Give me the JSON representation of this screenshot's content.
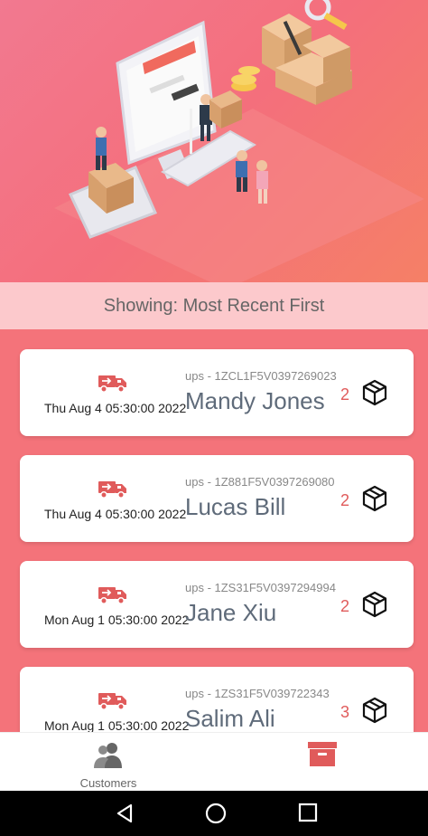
{
  "sort_label": "Showing: Most Recent First",
  "shipments": [
    {
      "date": "Thu Aug  4 05:30:00 2022",
      "tracking": "ups - 1ZCL1F5V0397269023",
      "name": "Mandy Jones",
      "count": "2"
    },
    {
      "date": "Thu Aug  4 05:30:00 2022",
      "tracking": "ups - 1Z881F5V0397269080",
      "name": "Lucas Bill",
      "count": "2"
    },
    {
      "date": "Mon Aug  1 05:30:00 2022",
      "tracking": "ups - 1ZS31F5V0397294994",
      "name": "Jane Xiu",
      "count": "2"
    },
    {
      "date": "Mon Aug  1 05:30:00 2022",
      "tracking": "ups - 1ZS31F5V039722343",
      "name": "Salim Ali",
      "count": "3"
    }
  ],
  "nav": {
    "customers_label": "Customers",
    "customers_icon": "customers-icon",
    "archive_icon": "archive-box-icon"
  },
  "colors": {
    "accent": "#e05b5b",
    "background": "#f4737a",
    "sort_bar": "#fcc9cc"
  }
}
